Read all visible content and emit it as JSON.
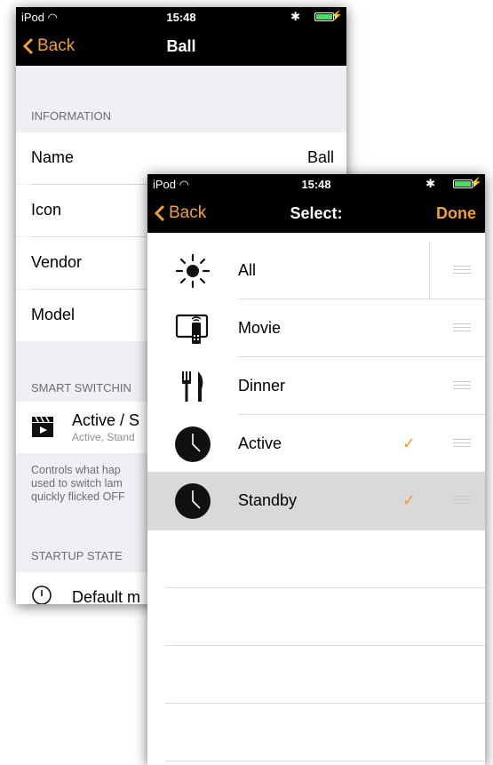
{
  "back_screen": {
    "status": {
      "carrier": "iPod",
      "time": "15:48"
    },
    "nav": {
      "back": "Back",
      "title": "Ball"
    },
    "information": {
      "header": "INFORMATION",
      "rows": [
        {
          "label": "Name",
          "value": "Ball"
        },
        {
          "label": "Icon",
          "value": ""
        },
        {
          "label": "Vendor",
          "value": ""
        },
        {
          "label": "Model",
          "value": ""
        }
      ]
    },
    "smart_switching": {
      "header": "SMART SWITCHIN",
      "title": "Active / S",
      "subtitle": "Active, Stand",
      "footnote": [
        "Controls what hap",
        "used to switch lam",
        "quickly flicked OFF"
      ]
    },
    "startup": {
      "header": "STARTUP STATE",
      "label": "Default m"
    }
  },
  "front_screen": {
    "status": {
      "carrier": "iPod",
      "time": "15:48"
    },
    "nav": {
      "back": "Back",
      "title": "Select:",
      "done": "Done"
    },
    "items": [
      {
        "label": "All",
        "icon": "sun-icon",
        "checked": false,
        "selected": false
      },
      {
        "label": "Movie",
        "icon": "tv-remote-icon",
        "checked": false,
        "selected": false
      },
      {
        "label": "Dinner",
        "icon": "fork-knife-icon",
        "checked": false,
        "selected": false
      },
      {
        "label": "Active",
        "icon": "clock-icon",
        "checked": true,
        "selected": false
      },
      {
        "label": "Standby",
        "icon": "clock-icon",
        "checked": true,
        "selected": true
      }
    ],
    "check_mark": "✓"
  },
  "colors": {
    "accent": "#f0a030",
    "bar": "#000000",
    "selected_row": "#d9d9d9",
    "grouped_bg": "#efeff4"
  }
}
